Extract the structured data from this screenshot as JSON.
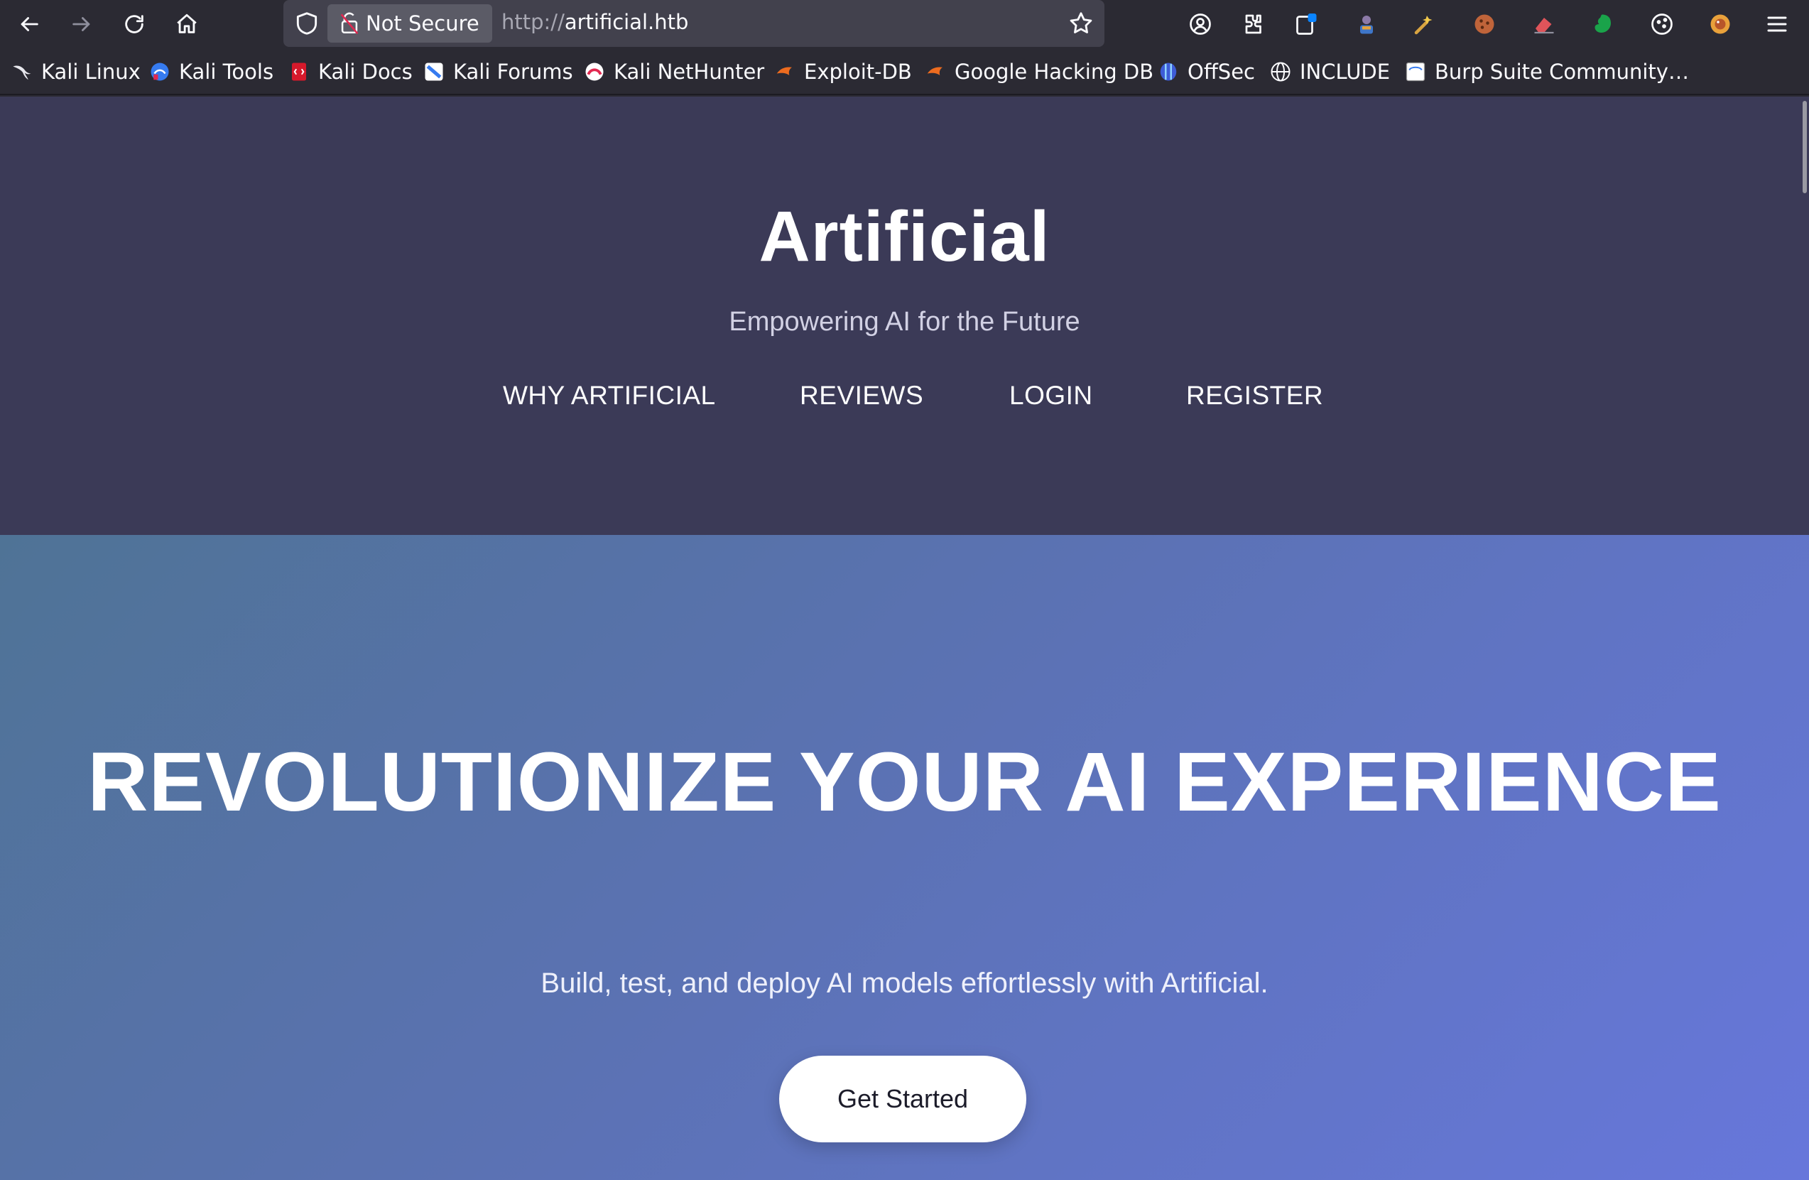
{
  "browser": {
    "url_scheme": "http://",
    "url_host": "artificial.htb",
    "security_label": "Not Secure",
    "icons": [
      "back-icon",
      "forward-icon",
      "reload-icon",
      "home-icon",
      "shield-icon",
      "broken-lock-icon",
      "bookmark-star-icon",
      "account-icon",
      "extensions-icon",
      "menu-icon"
    ]
  },
  "bookmarks": [
    {
      "label": "Kali Linux",
      "icon": "kali-dragon-icon"
    },
    {
      "label": "Kali Tools",
      "icon": "kali-tools-icon"
    },
    {
      "label": "Kali Docs",
      "icon": "kali-docs-icon"
    },
    {
      "label": "Kali Forums",
      "icon": "kali-forums-icon"
    },
    {
      "label": "Kali NetHunter",
      "icon": "kali-nethunter-icon"
    },
    {
      "label": "Exploit-DB",
      "icon": "exploit-db-icon"
    },
    {
      "label": "Google Hacking DB",
      "icon": "ghdb-icon"
    },
    {
      "label": "OffSec",
      "icon": "offsec-icon"
    },
    {
      "label": "INCLUDE",
      "icon": "globe-icon"
    },
    {
      "label": "Burp Suite Community…",
      "icon": "burp-suite-icon"
    }
  ],
  "site": {
    "title": "Artificial",
    "tagline": "Empowering AI for the Future",
    "nav": [
      "WHY ARTIFICIAL",
      "REVIEWS",
      "LOGIN",
      "REGISTER"
    ]
  },
  "hero": {
    "title": "REVOLUTIONIZE YOUR AI EXPERIENCE",
    "subtitle": "Build, test, and deploy AI models effortlessly with Artificial.",
    "cta": "Get Started"
  },
  "colors": {
    "chrome_bg": "#2b2a33",
    "urlbar_bg": "#42414d",
    "header_bg": "#3b3a57",
    "hero_gradient_start": "#4f7396",
    "hero_gradient_end": "#6777db",
    "cta_bg": "#ffffff"
  }
}
